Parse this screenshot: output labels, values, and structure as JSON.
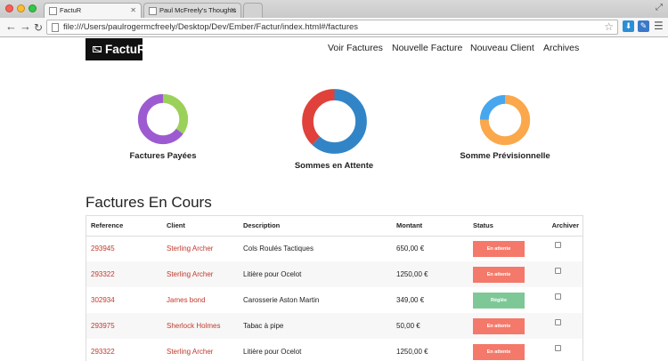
{
  "browser": {
    "tabs": [
      {
        "title": "FactuR",
        "active": true
      },
      {
        "title": "Paul McFreely's Thoughts",
        "active": false
      }
    ],
    "url": "file:///Users/paulrogermcfreely/Desktop/Dev/Ember/Factur/index.html#/factures",
    "icons": [
      "back-arrow-icon",
      "forward-arrow-icon",
      "reload-icon",
      "star-icon",
      "download-extension-icon",
      "shield-extension-icon",
      "menu-icon"
    ]
  },
  "header": {
    "brand": "FactuR",
    "nav": [
      "Voir Factures",
      "Nouvelle Facture",
      "Nouveau Client",
      "Archives"
    ]
  },
  "donuts": [
    {
      "label": "Factures Payées",
      "segments": [
        {
          "fraction": 0.35,
          "color": "#9bd15b"
        },
        {
          "fraction": 0.65,
          "color": "#9d5bd1"
        }
      ]
    },
    {
      "label": "Sommes en Attente",
      "segments": [
        {
          "fraction": 0.62,
          "color": "#3185c7"
        },
        {
          "fraction": 0.38,
          "color": "#e0413b"
        }
      ]
    },
    {
      "label": "Somme Prévisionnelle",
      "segments": [
        {
          "fraction": 0.75,
          "color": "#fba74b"
        },
        {
          "fraction": 0.25,
          "color": "#46a7ee"
        }
      ]
    }
  ],
  "main": {
    "title": "Factures En Cours",
    "columns": [
      "Reference",
      "Client",
      "Description",
      "Montant",
      "Status",
      "Archiver"
    ],
    "rows": [
      {
        "ref": "293945",
        "client": "Sterling Archer",
        "desc": "Cols Roulés Tactiques",
        "amount": "650,00 €",
        "status": "En attente",
        "kind": "warn"
      },
      {
        "ref": "293322",
        "client": "Sterling Archer",
        "desc": "Litière pour Ocelot",
        "amount": "1250,00 €",
        "status": "En attente",
        "kind": "warn"
      },
      {
        "ref": "302934",
        "client": "James bond",
        "desc": "Carosserie Aston Martin",
        "amount": "349,00 €",
        "status": "Réglée",
        "kind": "ok"
      },
      {
        "ref": "293975",
        "client": "Sherlock Holmes",
        "desc": "Tabac à pipe",
        "amount": "50,00 €",
        "status": "En attente",
        "kind": "warn"
      },
      {
        "ref": "293322",
        "client": "Sterling Archer",
        "desc": "Litière pour Ocelot",
        "amount": "1250,00 €",
        "status": "En attente",
        "kind": "warn"
      }
    ]
  }
}
